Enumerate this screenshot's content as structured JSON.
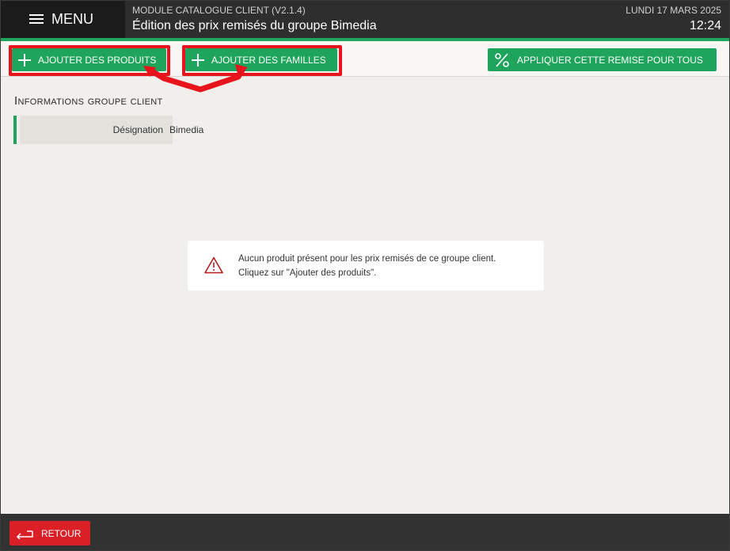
{
  "header": {
    "menu_label": "MENU",
    "module_title": "MODULE CATALOGUE CLIENT (V2.1.4)",
    "page_title": "Édition des prix remisés du groupe Bimedia",
    "date": "LUNDI 17 MARS 2025",
    "time": "12:24"
  },
  "toolbar": {
    "add_products_label": "AJOUTER DES PRODUITS",
    "add_families_label": "AJOUTER DES FAMILLES",
    "apply_discount_label": "APPLIQUER CETTE REMISE POUR TOUS"
  },
  "section": {
    "title": "Informations groupe client",
    "fields": [
      {
        "label": "Désignation",
        "value": "Bimedia"
      }
    ]
  },
  "message": {
    "line1": "Aucun produit présent pour les prix remisés de ce groupe client.",
    "line2": "Cliquez sur \"Ajouter des produits\"."
  },
  "footer": {
    "back_label": "RETOUR"
  },
  "colors": {
    "accent_green": "#1ea55b",
    "danger_red": "#db1f26",
    "highlight_red": "#e8141b",
    "header_dark": "#2e2e2e"
  },
  "icons": {
    "menu": "hamburger-icon",
    "add": "plus-icon",
    "discount": "percent-icon",
    "warning": "warning-triangle-icon",
    "back": "return-arrow-icon"
  }
}
